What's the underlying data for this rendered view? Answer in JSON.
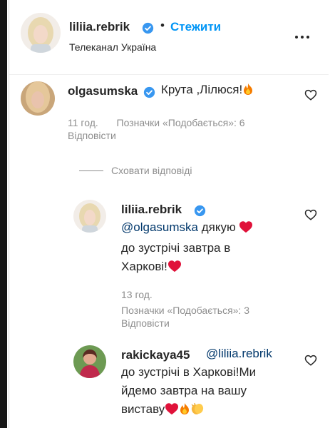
{
  "post_header": {
    "username": "liliia.rebrik",
    "follow_label": "Стежити",
    "subtitle": "Телеканал Україна"
  },
  "comments": [
    {
      "username": "olgasumska",
      "text": "Крута ,Лілюся!",
      "time": "11 год.",
      "likes": "Позначки «Подобається»: 6",
      "reply": "Відповісти"
    }
  ],
  "replies_toggle": "Сховати відповіді",
  "replies": [
    {
      "username": "liliia.rebrik",
      "mention": "@olgasumska",
      "line1_after_mention": " дякую ",
      "line2": "до зустрічі завтра в",
      "line3": "Харкові!",
      "time": "13 год.",
      "likes": "Позначки «Подобається»: 3",
      "reply": "Відповісти"
    },
    {
      "username": "rakickaya45",
      "mention": "@liliia.rebrik",
      "line2": "до зустрічі в Харкові!Ми",
      "line3": "йдемо завтра на вашу",
      "line4": "виставу"
    }
  ],
  "icons": {
    "verified": "verified-badge-icon",
    "heart": "heart-outline-icon",
    "more": "more-dots-icon",
    "fire": "fire-emoji-icon",
    "red_heart": "red-heart-emoji-icon",
    "clap": "clapping-hands-emoji-icon"
  },
  "colors": {
    "link": "#0095f6",
    "verified": "#3897f0",
    "secondary_text": "#8e8e8e"
  }
}
